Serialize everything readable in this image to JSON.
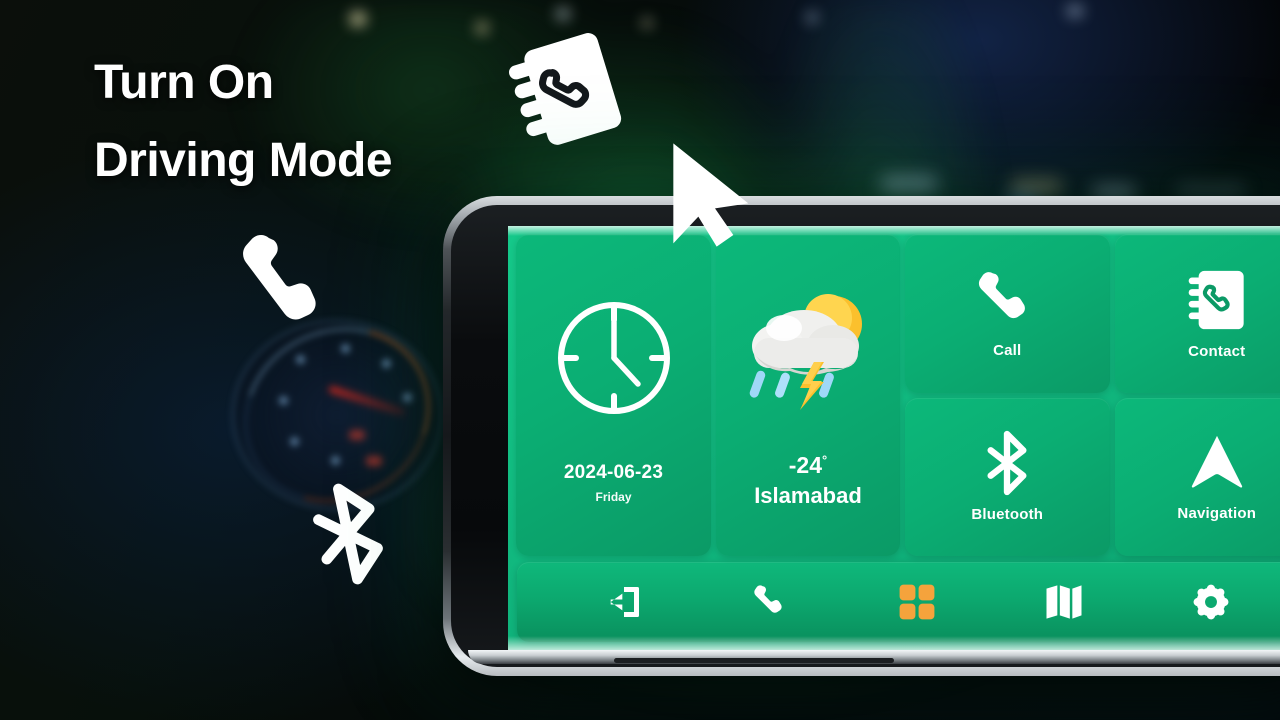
{
  "headline": {
    "line1": "Turn On",
    "line2": "Driving Mode"
  },
  "colors": {
    "screen_green": "#12bd82",
    "tile_green_light": "#0cb87a",
    "tile_green_dark": "#0b9a66",
    "navbar_green": "#0ca96f",
    "accent_orange": "#f5a33c",
    "text_white": "#ffffff",
    "background_dark": "#05070a"
  },
  "phone": {
    "orientation": "landscape",
    "bezel_color": "#0a0c0e",
    "rim_color": "#d9dde0"
  },
  "decorations": [
    {
      "name": "floating-phone-icon",
      "icon": "phone-handset-icon"
    },
    {
      "name": "floating-bluetooth-icon",
      "icon": "bluetooth-icon"
    },
    {
      "name": "floating-contacts-icon",
      "icon": "contacts-book-icon"
    },
    {
      "name": "mouse-cursor",
      "icon": "cursor-arrow-icon"
    }
  ],
  "screen": {
    "clock_tile": {
      "icon": "analog-clock-icon",
      "date": "2024-06-23",
      "day": "Friday"
    },
    "weather_tile": {
      "icon": "cloud-sun-rain-lightning-icon",
      "temperature": "-24",
      "degree_symbol": "°",
      "city": "Islamabad"
    },
    "app_tiles": [
      {
        "label": "Call",
        "icon": "phone-handset-icon"
      },
      {
        "label": "Contact",
        "icon": "contacts-book-icon"
      },
      {
        "label": "Bluetooth",
        "icon": "bluetooth-icon"
      },
      {
        "label": "Navigation",
        "icon": "navigation-arrow-icon"
      }
    ],
    "navbar": [
      {
        "name": "exit",
        "icon": "exit-door-icon",
        "active": false
      },
      {
        "name": "phone",
        "icon": "phone-handset-icon",
        "active": false
      },
      {
        "name": "apps",
        "icon": "grid-apps-icon",
        "active": true
      },
      {
        "name": "map",
        "icon": "map-icon",
        "active": false
      },
      {
        "name": "settings",
        "icon": "gear-icon",
        "active": false
      }
    ]
  }
}
